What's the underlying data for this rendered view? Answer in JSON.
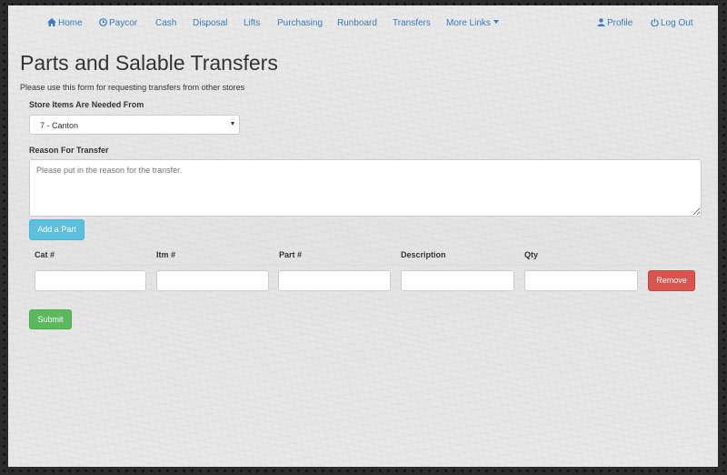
{
  "nav": {
    "home": "Home",
    "paycor": "Paycor",
    "cash": "Cash",
    "disposal": "Disposal",
    "lifts": "Lifts",
    "purchasing": "Purchasing",
    "runboard": "Runboard",
    "transfers": "Transfers",
    "more_links": "More Links",
    "profile": "Profile",
    "logout": "Log Out",
    "link_color": "#3a7bbf"
  },
  "page": {
    "title": "Parts and Salable Transfers",
    "subtitle": "Please use this form for requesting transfers from other stores"
  },
  "form": {
    "store_label": "Store Items Are Needed From",
    "store_selected": "7 - Canton",
    "reason_label": "Reason For Transfer",
    "reason_placeholder": "Please put in the reason for the transfer.",
    "add_part": "Add a Part",
    "submit": "Submit"
  },
  "table": {
    "headers": [
      "Cat #",
      "Itm #",
      "Part #",
      "Description",
      "Qty"
    ],
    "rows": [
      {
        "cat": "",
        "itm": "",
        "part": "",
        "description": "",
        "qty": "",
        "remove": "Remove"
      }
    ]
  }
}
